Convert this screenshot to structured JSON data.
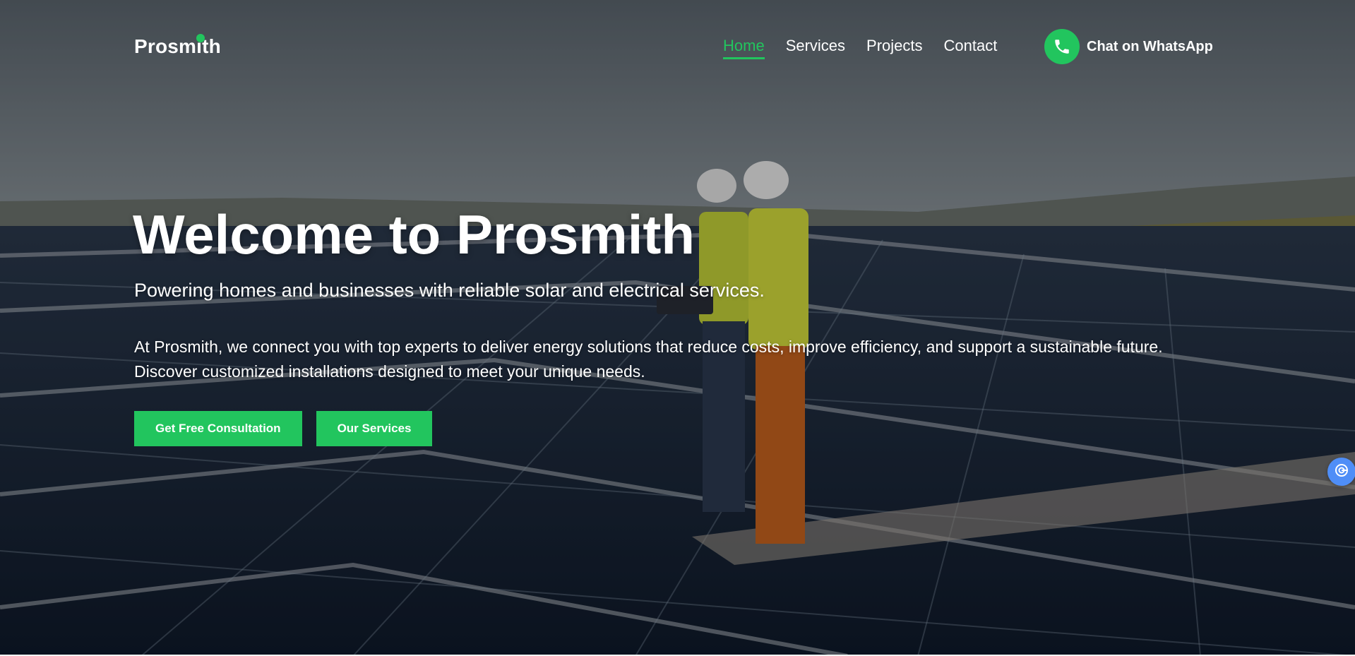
{
  "brand": {
    "name": "Prosmith",
    "accent_color": "#22c55e"
  },
  "nav": {
    "items": [
      {
        "label": "Home",
        "active": true
      },
      {
        "label": "Services",
        "active": false
      },
      {
        "label": "Projects",
        "active": false
      },
      {
        "label": "Contact",
        "active": false
      }
    ]
  },
  "whatsapp": {
    "label": "Chat on WhatsApp",
    "icon": "phone-icon"
  },
  "hero": {
    "title": "Welcome to Prosmith",
    "subtitle": "Powering homes and businesses with reliable solar and electrical services.",
    "description": "At Prosmith, we connect you with top experts to deliver energy solutions that reduce costs, improve efficiency, and support a sustainable future. Discover customized installations designed to meet your unique needs.",
    "background": "solar-panel-rooftop-workers-image",
    "buttons": {
      "primary": "Get Free Consultation",
      "secondary": "Our Services"
    }
  },
  "side_widget": {
    "icon": "assistant-icon",
    "color": "#4f8ef7"
  }
}
